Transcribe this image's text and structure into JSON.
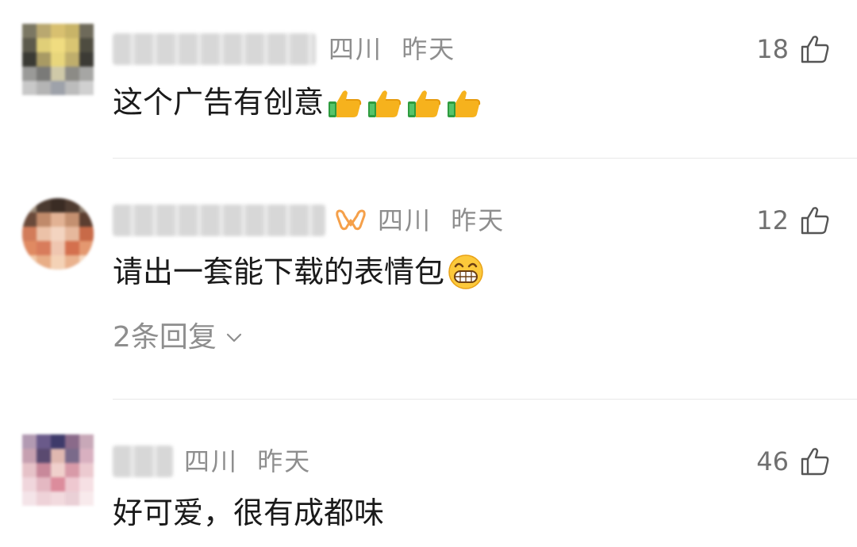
{
  "comments": [
    {
      "location": "四川",
      "time": "昨天",
      "likes": "18",
      "text": "这个广告有创意",
      "emoji": "thumbs-up-icon",
      "emoji_count": 4
    },
    {
      "location": "四川",
      "time": "昨天",
      "likes": "12",
      "text": "请出一套能下载的表情包",
      "emoji": "grinning-face-icon",
      "replies_label": "2条回复",
      "badge": "vip-badge-icon"
    },
    {
      "location": "四川",
      "time": "昨天",
      "likes": "46",
      "text": "好可爱，很有成都味"
    }
  ],
  "colors": {
    "text": "#1a1a1a",
    "meta": "#8e8e8e",
    "badge": "#f5a04a",
    "divider": "#e8e8e8"
  }
}
